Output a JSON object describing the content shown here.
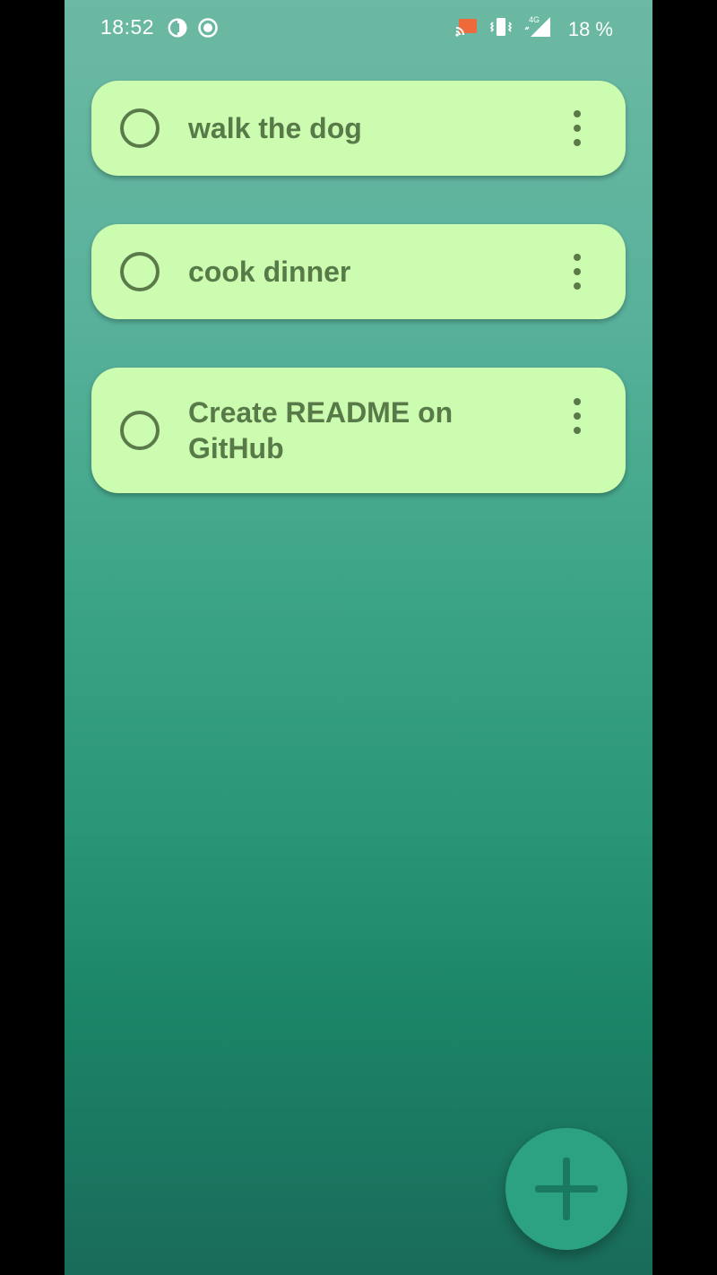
{
  "status_bar": {
    "time": "18:52",
    "battery": "18 %",
    "network": "4G",
    "left_icons": [
      "data-saver-icon",
      "record-icon"
    ],
    "right_icons": [
      "cast-icon",
      "vibrate-icon",
      "signal-icon"
    ]
  },
  "tasks": [
    {
      "text": "walk the dog",
      "completed": false
    },
    {
      "text": "cook dinner",
      "completed": false
    },
    {
      "text": "Create README on GitHub",
      "completed": false
    }
  ],
  "fab": {
    "icon": "plus-icon"
  },
  "colors": {
    "card_background": "#ccfcb0",
    "card_text": "#587a48",
    "fab": "#2ca282",
    "gradient_top": "#6cb9a3",
    "gradient_bottom": "#1a6b5a"
  }
}
